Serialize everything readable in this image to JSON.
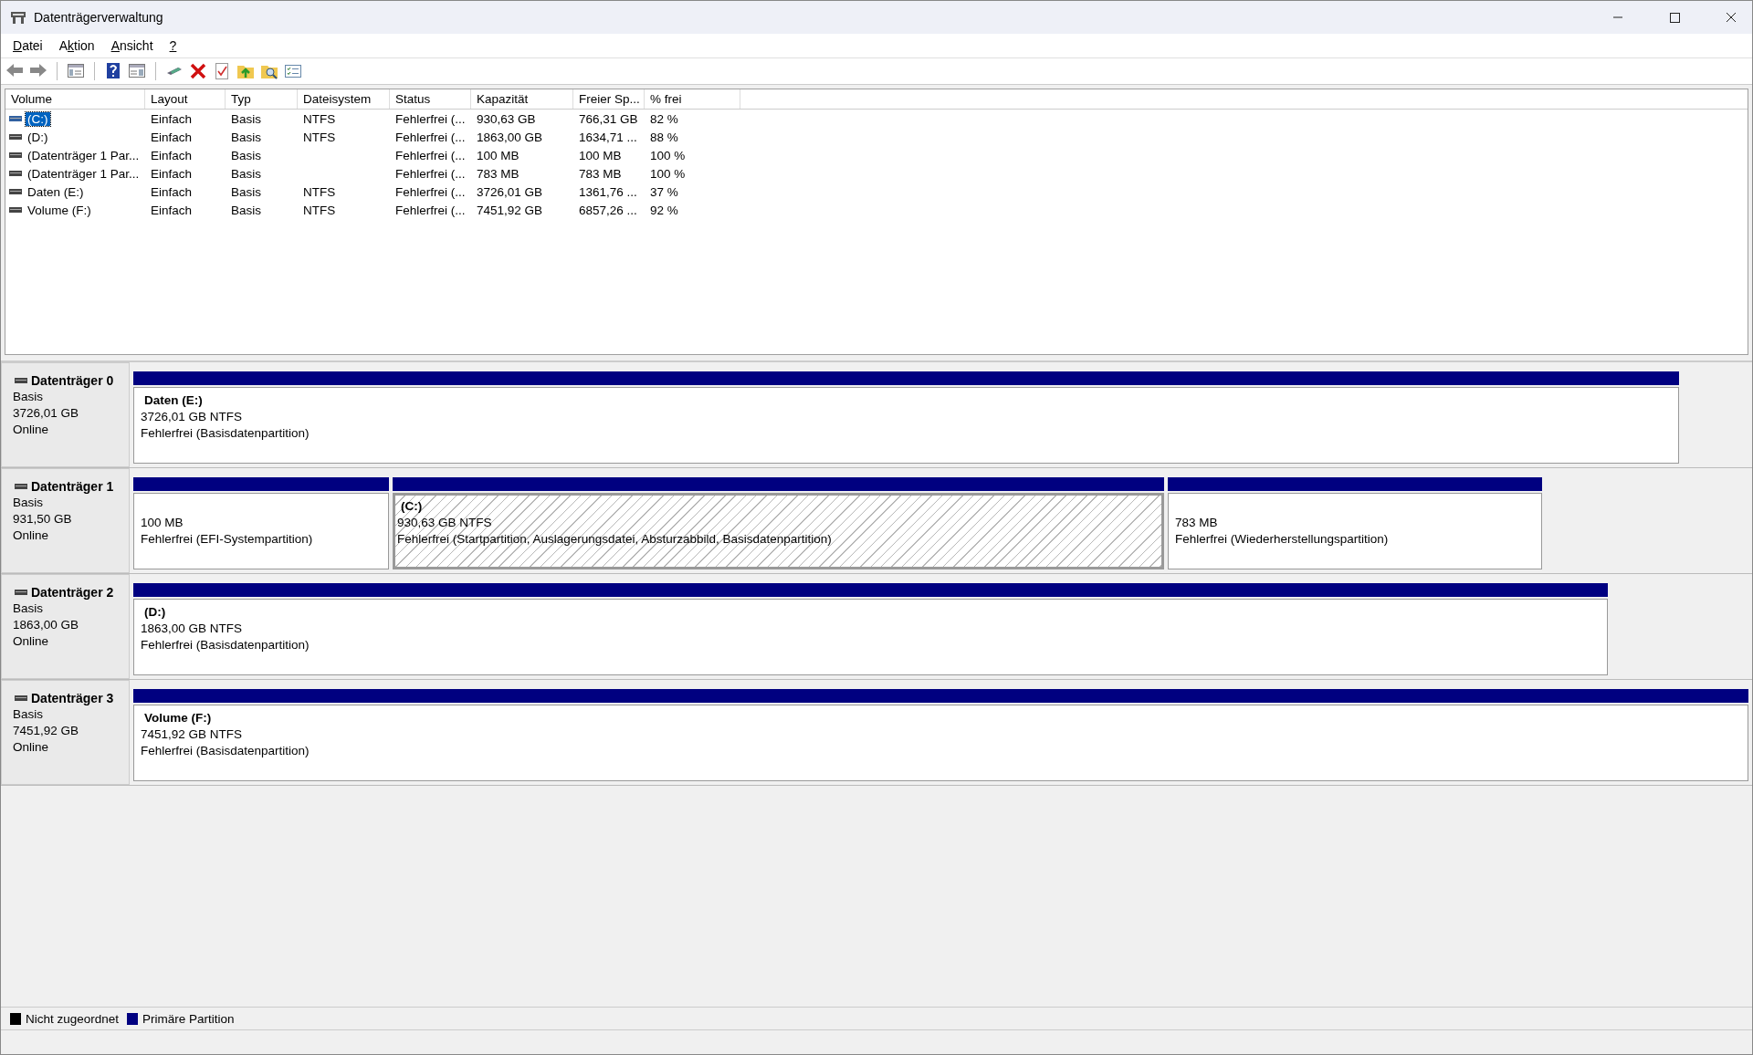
{
  "window": {
    "title": "Datenträgerverwaltung"
  },
  "menu": [
    {
      "key": "D",
      "rest": "atei"
    },
    {
      "before": "A",
      "key": "k",
      "rest": "tion"
    },
    {
      "key": "A",
      "rest": "nsicht"
    },
    {
      "key": "?"
    }
  ],
  "toolbar": [
    {
      "kind": "back"
    },
    {
      "kind": "forward"
    },
    {
      "kind": "sep"
    },
    {
      "kind": "tree"
    },
    {
      "kind": "sep"
    },
    {
      "kind": "help"
    },
    {
      "kind": "pane"
    },
    {
      "kind": "sep"
    },
    {
      "kind": "connect"
    },
    {
      "kind": "delete"
    },
    {
      "kind": "check"
    },
    {
      "kind": "folder-up"
    },
    {
      "kind": "folder-search"
    },
    {
      "kind": "list"
    }
  ],
  "table": {
    "columns": [
      "Volume",
      "Layout",
      "Typ",
      "Dateisystem",
      "Status",
      "Kapazität",
      "Freier Sp...",
      "% frei"
    ],
    "rows": [
      {
        "selected": true,
        "cells": [
          "(C:)",
          "Einfach",
          "Basis",
          "NTFS",
          "Fehlerfrei (...",
          "930,63 GB",
          "766,31 GB",
          "82 %"
        ]
      },
      {
        "selected": false,
        "cells": [
          "(D:)",
          "Einfach",
          "Basis",
          "NTFS",
          "Fehlerfrei (...",
          "1863,00 GB",
          "1634,71 ...",
          "88 %"
        ]
      },
      {
        "selected": false,
        "cells": [
          "(Datenträger 1 Par...",
          "Einfach",
          "Basis",
          "",
          "Fehlerfrei (...",
          "100 MB",
          "100 MB",
          "100 %"
        ]
      },
      {
        "selected": false,
        "cells": [
          "(Datenträger 1 Par...",
          "Einfach",
          "Basis",
          "",
          "Fehlerfrei (...",
          "783 MB",
          "783 MB",
          "100 %"
        ]
      },
      {
        "selected": false,
        "cells": [
          "Daten (E:)",
          "Einfach",
          "Basis",
          "NTFS",
          "Fehlerfrei (...",
          "3726,01 GB",
          "1361,76 ...",
          "37 %"
        ]
      },
      {
        "selected": false,
        "cells": [
          "Volume (F:)",
          "Einfach",
          "Basis",
          "NTFS",
          "Fehlerfrei (...",
          "7451,92 GB",
          "6857,26 ...",
          "92 %"
        ]
      }
    ]
  },
  "disks": [
    {
      "name": "Datenträger 0",
      "type": "Basis",
      "size": "3726,01 GB",
      "state": "Online",
      "partitions": [
        {
          "name": "Daten  (E:)",
          "size": "3726,01 GB NTFS",
          "status": "Fehlerfrei (Basisdatenpartition)",
          "selected": false
        }
      ]
    },
    {
      "name": "Datenträger 1",
      "type": "Basis",
      "size": "931,50 GB",
      "state": "Online",
      "partitions": [
        {
          "size": "100 MB",
          "status": "Fehlerfrei (EFI-Systempartition)",
          "selected": false
        },
        {
          "name": "(C:)",
          "size": "930,63 GB NTFS",
          "status": "Fehlerfrei (Startpartition, Auslagerungsdatei, Absturzabbild, Basisdatenpartition)",
          "selected": true
        },
        {
          "size": "783 MB",
          "status": "Fehlerfrei (Wiederherstellungspartition)",
          "selected": false
        }
      ]
    },
    {
      "name": "Datenträger 2",
      "type": "Basis",
      "size": "1863,00 GB",
      "state": "Online",
      "partitions": [
        {
          "name": "(D:)",
          "size": "1863,00 GB NTFS",
          "status": "Fehlerfrei (Basisdatenpartition)",
          "selected": false
        }
      ]
    },
    {
      "name": "Datenträger 3",
      "type": "Basis",
      "size": "7451,92 GB",
      "state": "Online",
      "partitions": [
        {
          "name": "Volume  (F:)",
          "size": "7451,92 GB NTFS",
          "status": "Fehlerfrei (Basisdatenpartition)",
          "selected": false
        }
      ]
    }
  ],
  "legend": [
    {
      "label": "Nicht zugeordnet",
      "color": "#000000"
    },
    {
      "label": "Primäre Partition",
      "color": "#000080"
    }
  ]
}
